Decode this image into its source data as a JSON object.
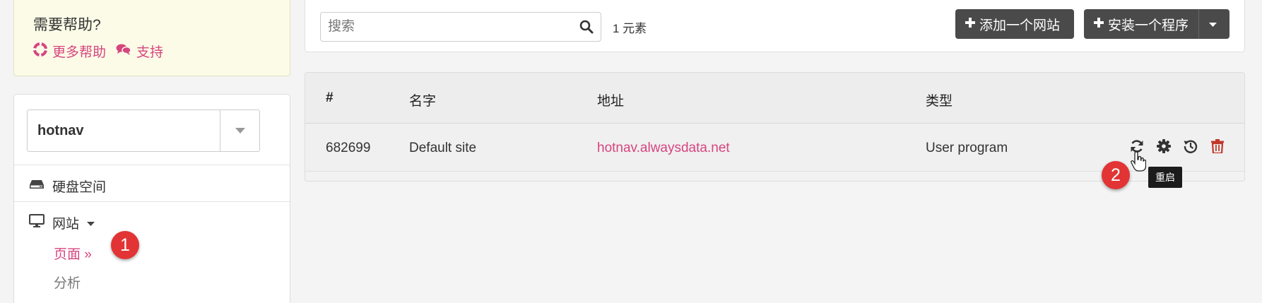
{
  "help": {
    "title": "需要帮助?",
    "more_help": "更多帮助",
    "support": "支持"
  },
  "sidebar": {
    "site_select_value": "hotnav",
    "disk_space": "硬盘空间",
    "websites": "网站",
    "pages": "页面 »",
    "analysis": "分析"
  },
  "toolbar": {
    "search_placeholder": "搜索",
    "count_text": "1 元素",
    "add_site": "添加一个网站",
    "install_program": "安装一个程序"
  },
  "table": {
    "headers": {
      "id": "#",
      "name": "名字",
      "address": "地址",
      "type": "类型"
    },
    "rows": [
      {
        "id": "682699",
        "name": "Default site",
        "address": "hotnav.alwaysdata.net",
        "type": "User program"
      }
    ]
  },
  "tooltip": {
    "text": "重启"
  },
  "annotations": {
    "badge1": "1",
    "badge2": "2"
  },
  "colors": {
    "accent": "#d6457f",
    "dark_button": "#4a4a4a",
    "badge": "#e23434",
    "delete": "#c0392b"
  }
}
